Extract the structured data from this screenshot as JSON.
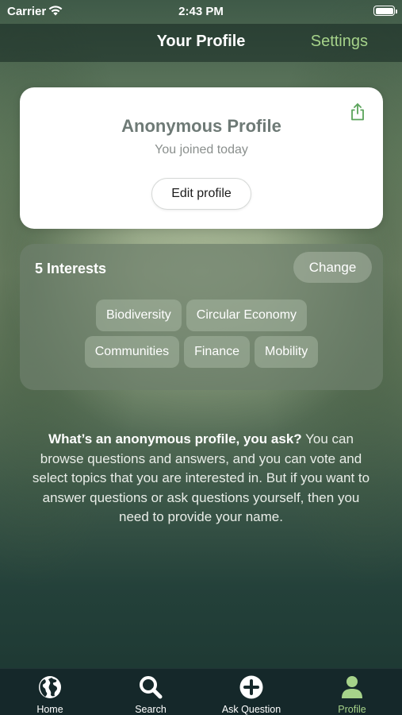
{
  "status_bar": {
    "carrier": "Carrier",
    "time": "2:43 PM"
  },
  "nav": {
    "title": "Your Profile",
    "settings_label": "Settings"
  },
  "profile": {
    "name": "Anonymous Profile",
    "joined": "You joined today",
    "edit_label": "Edit profile"
  },
  "interests": {
    "title": "5 Interests",
    "change_label": "Change",
    "tags": [
      "Biodiversity",
      "Circular Economy",
      "Communities",
      "Finance",
      "Mobility"
    ]
  },
  "info": {
    "question": "What’s an anonymous profile, you ask?",
    "body": " You can browse questions and answers, and you can vote and select topics that you are interested in. But if you want to answer questions or ask questions yourself, then you need to provide your name."
  },
  "tabs": [
    {
      "label": "Home",
      "icon": "globe-icon"
    },
    {
      "label": "Search",
      "icon": "search-icon"
    },
    {
      "label": "Ask Question",
      "icon": "plus-circle-icon"
    },
    {
      "label": "Profile",
      "icon": "person-icon",
      "active": true
    }
  ],
  "colors": {
    "accent": "#a6d38a",
    "tab_bar": "#15282a"
  }
}
